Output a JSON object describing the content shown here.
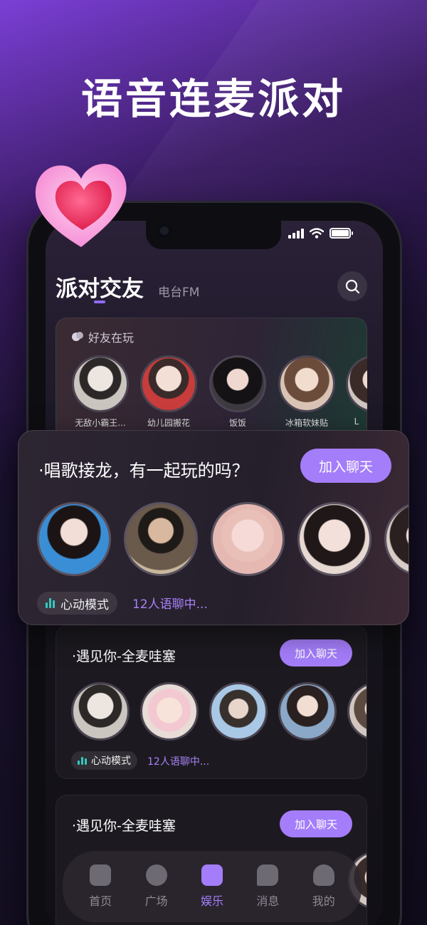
{
  "headline": "语音连麦派对",
  "header": {
    "title": "派对交友",
    "secondary_tab": "电台FM"
  },
  "friends": {
    "heading": "好友在玩",
    "items": [
      {
        "name": "无敌小霸王..."
      },
      {
        "name": "幼儿园搬花"
      },
      {
        "name": "饭饭"
      },
      {
        "name": "冰箱软妹贴"
      },
      {
        "name": "L"
      }
    ]
  },
  "rooms": [
    {
      "title": "·唱歌接龙，有一起玩的吗？",
      "join_label": "加入聊天",
      "mode_label": "心动模式",
      "count_text": "12人语聊中..."
    },
    {
      "title": "·遇见你-全麦哇塞",
      "join_label": "加入聊天",
      "mode_label": "心动模式",
      "count_text": "12人语聊中..."
    },
    {
      "title": "·遇见你-全麦哇塞",
      "join_label": "加入聊天"
    }
  ],
  "tabbar": {
    "items": [
      {
        "label": "首页",
        "icon": "home-icon"
      },
      {
        "label": "广场",
        "icon": "planet-icon"
      },
      {
        "label": "娱乐",
        "icon": "entertainment-icon",
        "active": true
      },
      {
        "label": "消息",
        "icon": "message-icon"
      },
      {
        "label": "我的",
        "icon": "profile-icon"
      }
    ]
  },
  "colors": {
    "accent": "#a47dfa",
    "mode_icon": "#36c9c0",
    "count_text": "#a981f8"
  }
}
